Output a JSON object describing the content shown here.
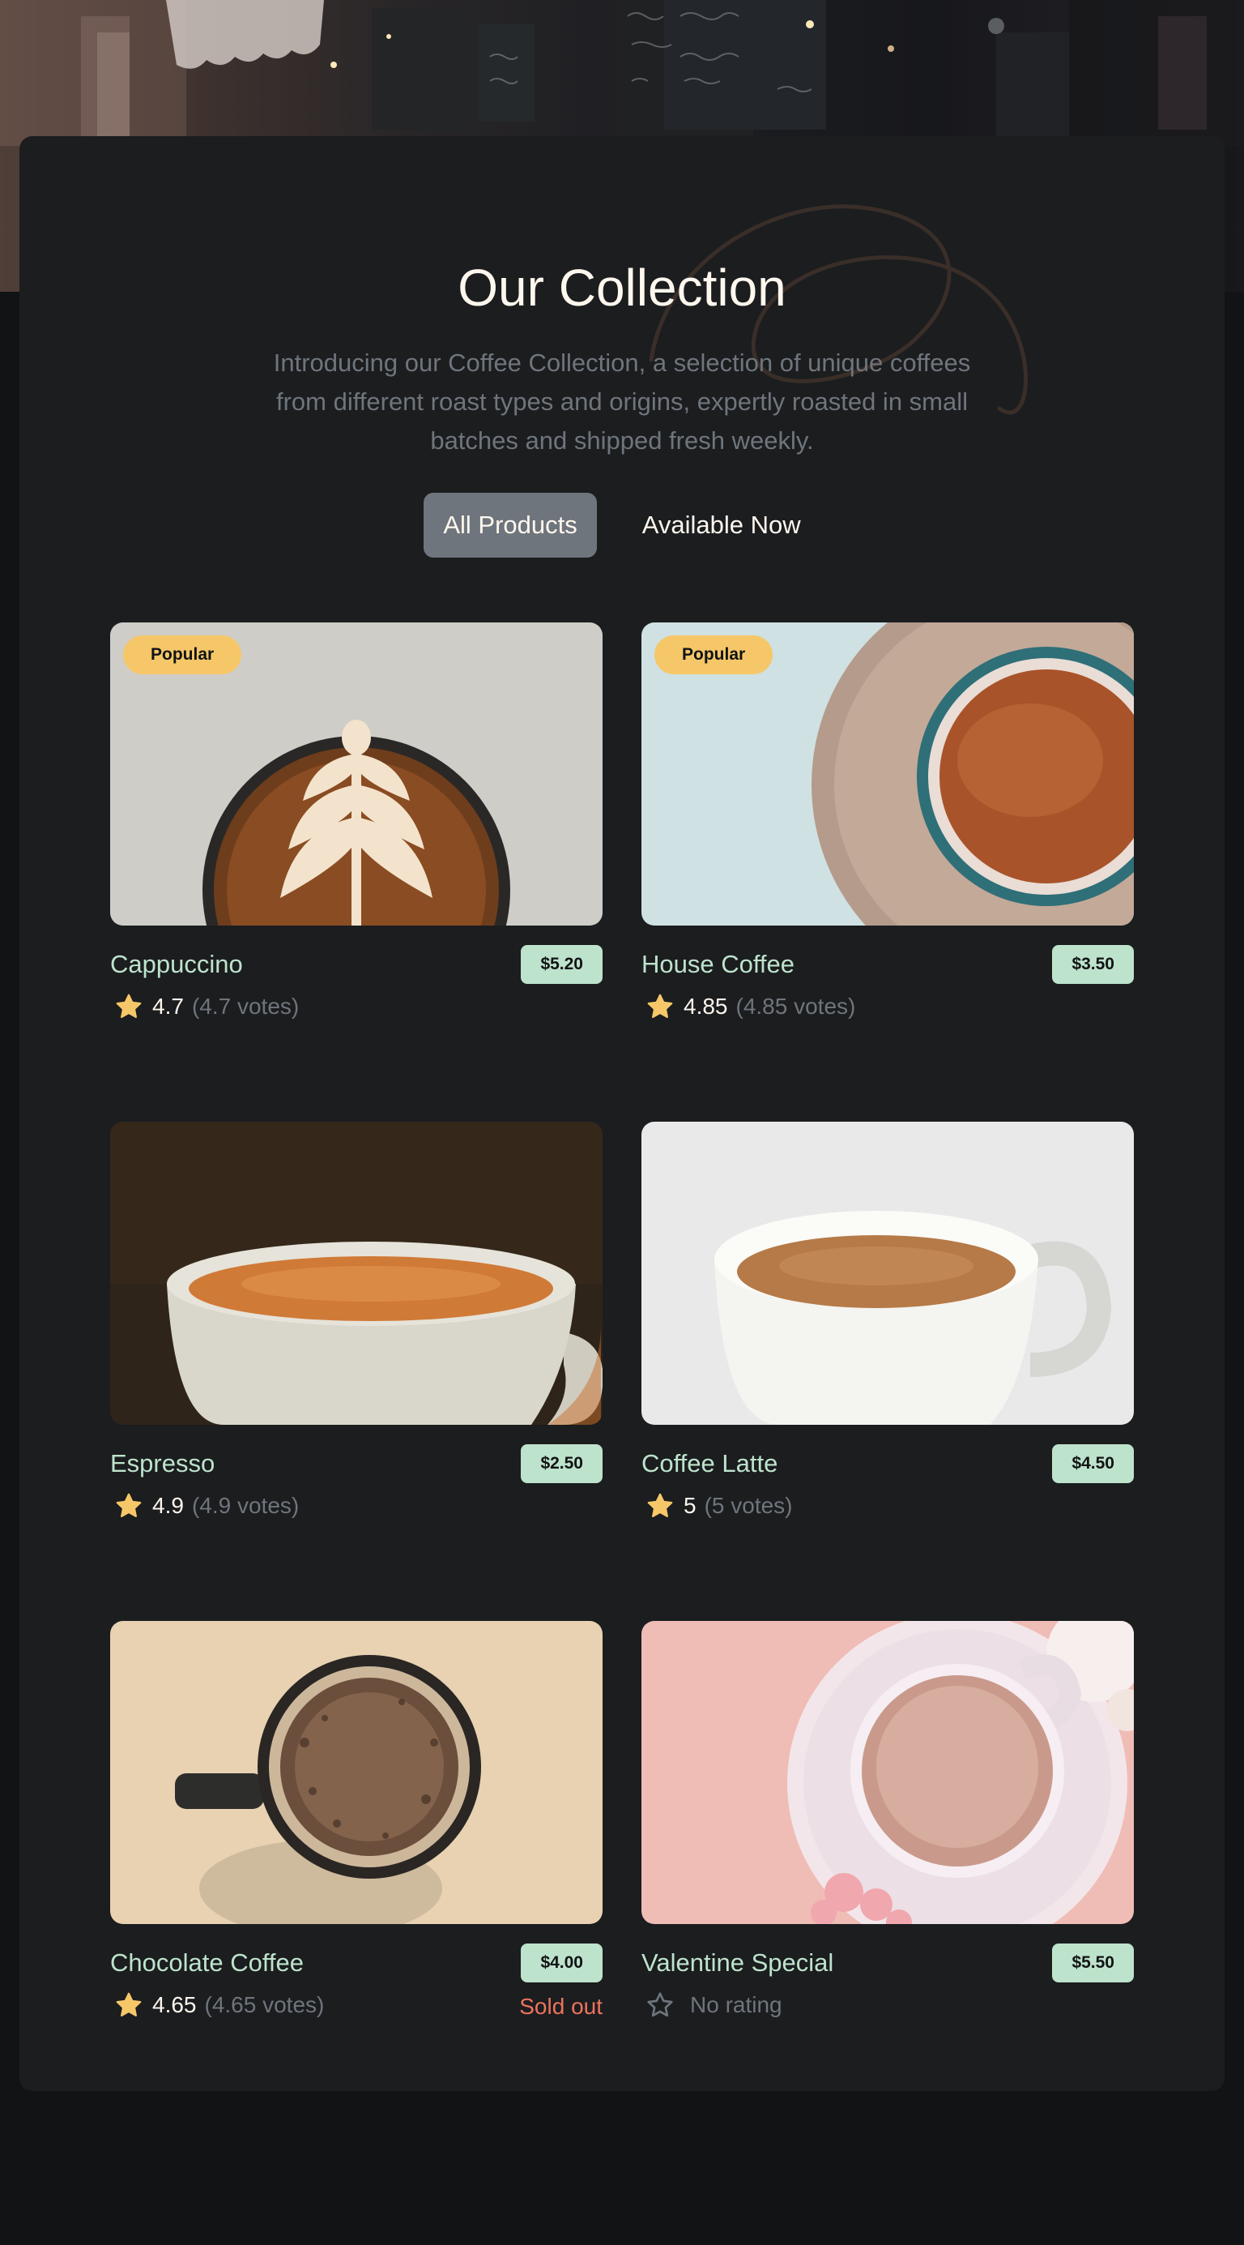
{
  "colors": {
    "page_background": "#111315",
    "card_background": "#1b1d1f",
    "title": "#fef7ee",
    "muted_text": "#6f757c",
    "product_name": "#bee3cc",
    "price_badge": "#bee3cc",
    "popular_badge": "#f6c768",
    "star": "#f6c768",
    "sold_out": "#ed735d"
  },
  "header": {
    "title": "Our Collection",
    "subtitle": "Introducing our Coffee Collection, a selection of unique coffees from different roast types and origins, expertly roasted in small batches and shipped fresh weekly."
  },
  "tabs": [
    {
      "label": "All Products",
      "active": true
    },
    {
      "label": "Available Now",
      "active": false
    }
  ],
  "products": [
    {
      "name": "Cappuccino",
      "price": "$5.20",
      "badge": "Popular",
      "rating": "4.7",
      "votes": "(4.7 votes)",
      "rated": true,
      "sold_out": false,
      "image": "latte-art-cup"
    },
    {
      "name": "House Coffee",
      "price": "$3.50",
      "badge": "Popular",
      "rating": "4.85",
      "votes": "(4.85 votes)",
      "rated": true,
      "sold_out": false,
      "image": "teal-cup-on-saucer"
    },
    {
      "name": "Espresso",
      "price": "$2.50",
      "rating": "4.9",
      "votes": "(4.9 votes)",
      "rated": true,
      "sold_out": false,
      "image": "espresso-cup"
    },
    {
      "name": "Coffee Latte",
      "price": "$4.50",
      "rating": "5",
      "votes": "(5 votes)",
      "rated": true,
      "sold_out": false,
      "image": "white-latte-cup"
    },
    {
      "name": "Chocolate Coffee",
      "price": "$4.00",
      "rating": "4.65",
      "votes": "(4.65 votes)",
      "rated": true,
      "sold_out": true,
      "sold_out_label": "Sold out",
      "image": "chocolate-cup"
    },
    {
      "name": "Valentine Special",
      "price": "$5.50",
      "rating_label": "No rating",
      "rated": false,
      "sold_out": false,
      "image": "pink-cup-with-roses"
    }
  ],
  "icons": {
    "star_filled": "star-filled-icon",
    "star_empty": "star-empty-icon"
  }
}
